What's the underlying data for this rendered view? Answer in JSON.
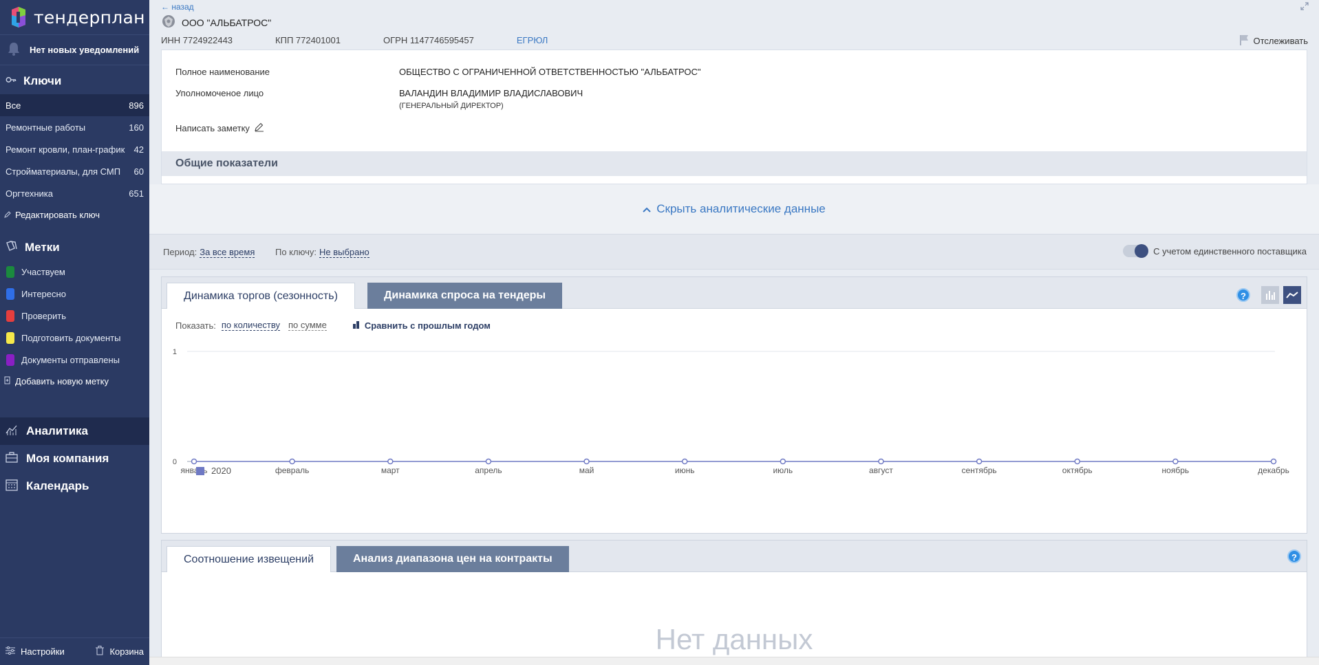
{
  "app": {
    "logo_text": "тендерплан"
  },
  "notifications": {
    "label": "Нет новых уведомлений"
  },
  "keys": {
    "title": "Ключи",
    "items": [
      {
        "label": "Все",
        "count": "896"
      },
      {
        "label": "Ремонтные работы",
        "count": "160"
      },
      {
        "label": "Ремонт кровли, план-график",
        "count": "42"
      },
      {
        "label": "Стройматериалы, для СМП",
        "count": "60"
      },
      {
        "label": "Оргтехника",
        "count": "651"
      }
    ],
    "edit_label": "Редактировать ключ"
  },
  "tags": {
    "title": "Метки",
    "items": [
      {
        "label": "Участвуем",
        "color": "#1b8a3e"
      },
      {
        "label": "Интересно",
        "color": "#2f6ee8"
      },
      {
        "label": "Проверить",
        "color": "#e53e3e"
      },
      {
        "label": "Подготовить документы",
        "color": "#f5e84a"
      },
      {
        "label": "Документы отправлены",
        "color": "#8a1fc4"
      }
    ],
    "add_label": "Добавить новую метку"
  },
  "nav": {
    "analytics": "Аналитика",
    "company": "Моя компания",
    "calendar": "Календарь",
    "settings": "Настройки",
    "trash": "Корзина"
  },
  "company": {
    "back": "← назад",
    "name": "ООО \"АЛЬБАТРОС\"",
    "inn": "ИНН 7724922443",
    "kpp": "КПП 772401001",
    "ogrn": "ОГРН 1147746595457",
    "egrul": "ЕГРЮЛ",
    "track": "Отслеживать",
    "full_name_label": "Полное наименование",
    "full_name": "ОБЩЕСТВО С ОГРАНИЧЕННОЙ ОТВЕТСТВЕННОСТЬЮ \"АЛЬБАТРОС\"",
    "person_label": "Уполномоченое лицо",
    "person": "ВАЛАНДИН ВЛАДИМИР ВЛАДИСЛАВОВИЧ",
    "person_role": "(ГЕНЕРАЛЬНЫЙ ДИРЕКТОР)",
    "note": "Написать заметку",
    "general": "Общие показатели"
  },
  "analytics": {
    "hide_label": "Скрыть аналитические данные",
    "period_label": "Период:",
    "period_value": "За все время",
    "key_label": "По ключу:",
    "key_value": "Не выбрано",
    "toggle_label": "С учетом единственного поставщика"
  },
  "panel1": {
    "tab_active": "Динамика торгов (сезонность)",
    "tab_inactive": "Динамика спроса на тендеры",
    "show_label": "Показать:",
    "opt_count": "по количеству",
    "opt_sum": "по сумме",
    "compare": "Сравнить с прошлым годом",
    "help": "?"
  },
  "chart_data": {
    "type": "line",
    "categories": [
      "январь",
      "февраль",
      "март",
      "апрель",
      "май",
      "июнь",
      "июль",
      "август",
      "сентябрь",
      "октябрь",
      "ноябрь",
      "декабрь"
    ],
    "series": [
      {
        "name": "2020",
        "values": [
          0,
          0,
          0,
          0,
          0,
          0,
          0,
          0,
          0,
          0,
          0,
          0
        ]
      }
    ],
    "yticks": [
      "0",
      "1"
    ],
    "ylim": [
      0,
      1
    ],
    "grid": true,
    "legend": "bottom-left",
    "color": "#6f79c4"
  },
  "panel2": {
    "tab_active": "Соотношение извещений",
    "tab_inactive": "Анализ диапазона цен на контракты",
    "no_data": "Нет данных",
    "help": "?"
  }
}
